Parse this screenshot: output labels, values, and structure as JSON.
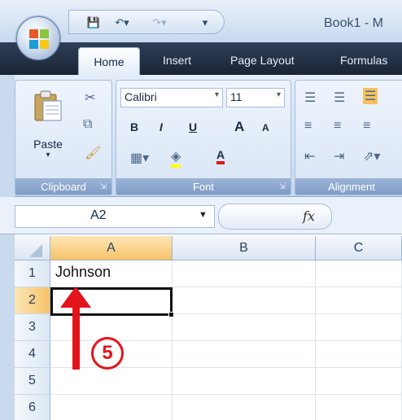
{
  "window": {
    "title": "Book1 - M"
  },
  "tabs": [
    {
      "label": "Home"
    },
    {
      "label": "Insert"
    },
    {
      "label": "Page Layout"
    },
    {
      "label": "Formulas"
    }
  ],
  "ribbon": {
    "clipboard": {
      "paste_label": "Paste",
      "group_label": "Clipboard"
    },
    "font": {
      "font_name": "Calibri",
      "font_size": "11",
      "group_label": "Font",
      "bold": "B",
      "italic": "I",
      "underline": "U",
      "grow": "A",
      "shrink": "A",
      "font_color_letter": "A"
    },
    "alignment": {
      "group_label": "Alignment"
    }
  },
  "formula_bar": {
    "name_box": "A2",
    "fx": "fx",
    "content": ""
  },
  "grid": {
    "columns": [
      "A",
      "B",
      "C"
    ],
    "rows": [
      "1",
      "2",
      "3",
      "4",
      "5",
      "6"
    ],
    "cells": {
      "A1": "Johnson"
    },
    "selected_cell": "A2"
  },
  "annotation": {
    "step": "5"
  },
  "colors": {
    "accent_red": "#e4141b",
    "selection_orange": "#f7c36a"
  }
}
